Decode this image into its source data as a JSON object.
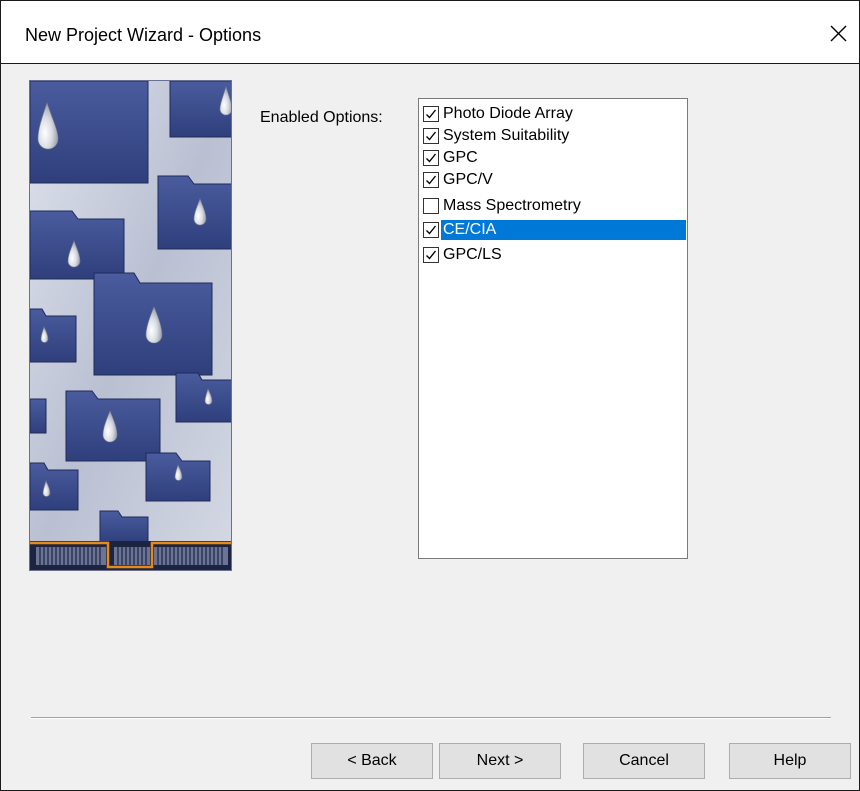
{
  "window": {
    "title": "New Project Wizard - Options",
    "close_icon": "close-icon"
  },
  "options": {
    "label": "Enabled Options:",
    "items": [
      {
        "label": "Photo Diode Array",
        "checked": true,
        "selected": false
      },
      {
        "label": "System Suitability",
        "checked": true,
        "selected": false
      },
      {
        "label": "GPC",
        "checked": true,
        "selected": false
      },
      {
        "label": "GPC/V",
        "checked": true,
        "selected": false
      },
      {
        "label": "Mass Spectrometry",
        "checked": false,
        "selected": false
      },
      {
        "label": "CE/CIA",
        "checked": true,
        "selected": true
      },
      {
        "label": "GPC/LS",
        "checked": true,
        "selected": false
      }
    ]
  },
  "buttons": {
    "back": "< Back",
    "next": "Next >",
    "cancel": "Cancel",
    "help": "Help"
  },
  "colors": {
    "selection": "#0078d7",
    "folder": "#3a4c8e",
    "accent": "#e88a1a"
  }
}
